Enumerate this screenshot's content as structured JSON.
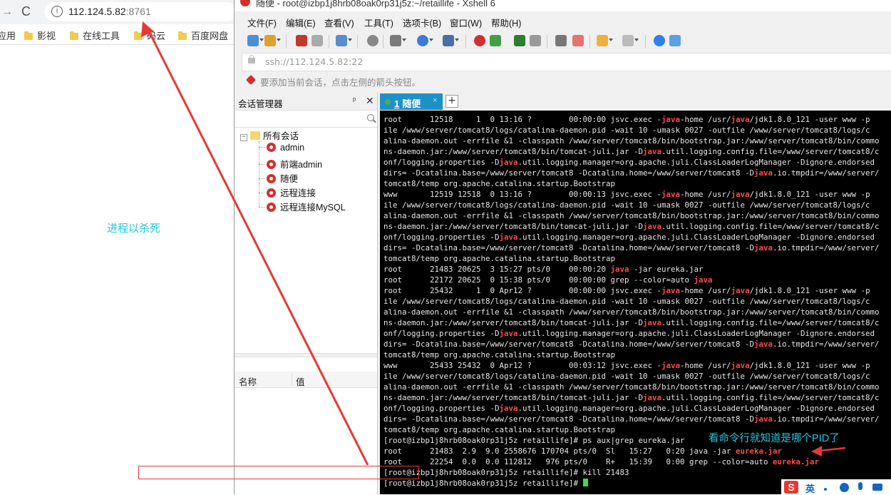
{
  "browser": {
    "back_glyph": "→",
    "reload_glyph": "C",
    "info_glyph": "i",
    "url_host": "112.124.5.82",
    "url_port": ":8761",
    "bookmarks": [
      {
        "label": "应用",
        "folder": false
      },
      {
        "label": "影视",
        "folder": true
      },
      {
        "label": "在线工具",
        "folder": true
      },
      {
        "label": "码云",
        "folder": true
      },
      {
        "label": "百度网盘",
        "folder": true
      }
    ],
    "note": "进程以杀死"
  },
  "xshell": {
    "title": "随便 - root@izbp1j8hrb08oak0rp31j5z:~/retaillife - Xshell 6",
    "menu": [
      "文件(F)",
      "编辑(E)",
      "查看(V)",
      "工具(T)",
      "选项卡(B)",
      "窗口(W)",
      "帮助(H)"
    ],
    "address": "ssh://112.124.5.82:22",
    "hint": "要添加当前会话，点击左侧的箭头按钮。",
    "session_manager": {
      "title": "会话管理器",
      "pin_glyph": "ᵖ",
      "close_glyph": "✕",
      "root": "所有会话",
      "items": [
        "admin",
        "前端admin",
        "随便",
        "远程连接",
        "远程连接MySQL"
      ],
      "props_col_name": "名称",
      "props_col_value": "值"
    },
    "tab": {
      "number": "1",
      "label": "随便",
      "close_glyph": "×",
      "new_glyph": "+"
    },
    "colors": {
      "highlight": "#ff4b4b",
      "tab": "#1e90c8",
      "annotation": "#26c6da",
      "arrow": "#e53935"
    }
  },
  "terminal": {
    "lines": [
      [
        {
          "t": "root      12518     1  0 13:16 ?        00:00:00 jsvc.exec -"
        },
        {
          "t": "java",
          "h": true
        },
        {
          "t": "-home /usr/"
        },
        {
          "t": "java",
          "h": true
        },
        {
          "t": "/jdk1.8.0_121 -user www -p"
        }
      ],
      [
        {
          "t": "ile /www/server/tomcat8/logs/catalina-daemon.pid -wait 10 -umask 0027 -outfile /www/server/tomcat8/logs/c"
        }
      ],
      [
        {
          "t": "alina-daemon.out -errfile &1 -classpath /www/server/tomcat8/bin/bootstrap.jar:/www/server/tomcat8/bin/commo"
        }
      ],
      [
        {
          "t": "ns-daemon.jar:/www/server/tomcat8/bin/tomcat-juli.jar -D"
        },
        {
          "t": "java",
          "h": true
        },
        {
          "t": ".util.logging.config.file=/www/server/tomcat8/c"
        }
      ],
      [
        {
          "t": "onf/logging.properties -D"
        },
        {
          "t": "java",
          "h": true
        },
        {
          "t": ".util.logging.manager=org.apache.juli.ClassLoaderLogManager -Dignore.endorsed"
        }
      ],
      [
        {
          "t": "dirs= -Dcatalina.base=/www/server/tomcat8 -Dcatalina.home=/www/server/tomcat8 -D"
        },
        {
          "t": "java",
          "h": true
        },
        {
          "t": ".io.tmpdir=/www/server/"
        }
      ],
      [
        {
          "t": "tomcat8/temp org.apache.catalina.startup.Bootstrap"
        }
      ],
      [
        {
          "t": "www       12519 12518  0 13:16 ?        00:00:13 jsvc.exec -"
        },
        {
          "t": "java",
          "h": true
        },
        {
          "t": "-home /usr/"
        },
        {
          "t": "java",
          "h": true
        },
        {
          "t": "/jdk1.8.0_121 -user www -p"
        }
      ],
      [
        {
          "t": "ile /www/server/tomcat8/logs/catalina-daemon.pid -wait 10 -umask 0027 -outfile /www/server/tomcat8/logs/c"
        }
      ],
      [
        {
          "t": "alina-daemon.out -errfile &1 -classpath /www/server/tomcat8/bin/bootstrap.jar:/www/server/tomcat8/bin/commo"
        }
      ],
      [
        {
          "t": "ns-daemon.jar:/www/server/tomcat8/bin/tomcat-juli.jar -D"
        },
        {
          "t": "java",
          "h": true
        },
        {
          "t": ".util.logging.config.file=/www/server/tomcat8/c"
        }
      ],
      [
        {
          "t": "onf/logging.properties -D"
        },
        {
          "t": "java",
          "h": true
        },
        {
          "t": ".util.logging.manager=org.apache.juli.ClassLoaderLogManager -Dignore.endorsed"
        }
      ],
      [
        {
          "t": "dirs= -Dcatalina.base=/www/server/tomcat8 -Dcatalina.home=/www/server/tomcat8 -D"
        },
        {
          "t": "java",
          "h": true
        },
        {
          "t": ".io.tmpdir=/www/server/"
        }
      ],
      [
        {
          "t": "tomcat8/temp org.apache.catalina.startup.Bootstrap"
        }
      ],
      [
        {
          "t": "root      21483 20625  3 15:27 pts/0    00:00:20 "
        },
        {
          "t": "java",
          "h": true
        },
        {
          "t": " -jar eureka.jar"
        }
      ],
      [
        {
          "t": "root      22172 20625  0 15:38 pts/0    00:00:00 grep --color=auto "
        },
        {
          "t": "java",
          "h": true
        }
      ],
      [
        {
          "t": "root      25432     1  0 Apr12 ?        00:00:00 jsvc.exec -"
        },
        {
          "t": "java",
          "h": true
        },
        {
          "t": "-home /usr/"
        },
        {
          "t": "java",
          "h": true
        },
        {
          "t": "/jdk1.8.0_121 -user www -p"
        }
      ],
      [
        {
          "t": "ile /www/server/tomcat8/logs/catalina-daemon.pid -wait 10 -umask 0027 -outfile /www/server/tomcat8/logs/c"
        }
      ],
      [
        {
          "t": "alina-daemon.out -errfile &1 -classpath /www/server/tomcat8/bin/bootstrap.jar:/www/server/tomcat8/bin/commo"
        }
      ],
      [
        {
          "t": "ns-daemon.jar:/www/server/tomcat8/bin/tomcat-juli.jar -D"
        },
        {
          "t": "java",
          "h": true
        },
        {
          "t": ".util.logging.config.file=/www/server/tomcat8/c"
        }
      ],
      [
        {
          "t": "onf/logging.properties -D"
        },
        {
          "t": "java",
          "h": true
        },
        {
          "t": ".util.logging.manager=org.apache.juli.ClassLoaderLogManager -Dignore.endorsed"
        }
      ],
      [
        {
          "t": "dirs= -Dcatalina.base=/www/server/tomcat8 -Dcatalina.home=/www/server/tomcat8 -D"
        },
        {
          "t": "java",
          "h": true
        },
        {
          "t": ".io.tmpdir=/www/server/"
        }
      ],
      [
        {
          "t": "tomcat8/temp org.apache.catalina.startup.Bootstrap"
        }
      ],
      [
        {
          "t": "www       25433 25432  0 Apr12 ?        00:03:12 jsvc.exec -"
        },
        {
          "t": "java",
          "h": true
        },
        {
          "t": "-home /usr/"
        },
        {
          "t": "java",
          "h": true
        },
        {
          "t": "/jdk1.8.0_121 -user www -p"
        }
      ],
      [
        {
          "t": "ile /www/server/tomcat8/logs/catalina-daemon.pid -wait 10 -umask 0027 -outfile /www/server/tomcat8/logs/c"
        }
      ],
      [
        {
          "t": "alina-daemon.out -errfile &1 -classpath /www/server/tomcat8/bin/bootstrap.jar:/www/server/tomcat8/bin/commo"
        }
      ],
      [
        {
          "t": "ns-daemon.jar:/www/server/tomcat8/bin/tomcat-juli.jar -D"
        },
        {
          "t": "java",
          "h": true
        },
        {
          "t": ".util.logging.config.file=/www/server/tomcat8/c"
        }
      ],
      [
        {
          "t": "onf/logging.properties -D"
        },
        {
          "t": "java",
          "h": true
        },
        {
          "t": ".util.logging.manager=org.apache.juli.ClassLoaderLogManager -Dignore.endorsed"
        }
      ],
      [
        {
          "t": "dirs= -Dcatalina.base=/www/server/tomcat8 -Dcatalina.home=/www/server/tomcat8 -D"
        },
        {
          "t": "java",
          "h": true
        },
        {
          "t": ".io.tmpdir=/www/server/"
        }
      ],
      [
        {
          "t": "tomcat8/temp org.apache.catalina.startup.Bootstrap"
        }
      ],
      [
        {
          "t": "[root@izbp1j8hrb08oak0rp31j5z retaillife]# ps aux|grep eureka.jar"
        }
      ],
      [
        {
          "t": "root      21483  2.9  9.0 2558676 170704 pts/0  Sl   15:27   0:20 java -jar "
        },
        {
          "t": "eureka.jar",
          "h": true
        }
      ],
      [
        {
          "t": "root      22254  0.0  0.0 112812   976 pts/0    R+   15:39   0:00 grep --color=auto "
        },
        {
          "t": "eureka.jar",
          "h": true
        }
      ],
      [
        {
          "t": "[root@izbp1j8hrb08oak0rp31j5z retaillife]# kill 21483"
        }
      ],
      [
        {
          "t": "[root@izbp1j8hrb08oak0rp31j5z retaillife]# "
        },
        {
          "cursor": true
        }
      ]
    ],
    "annotation": "看命令行就知道是哪个PID了"
  },
  "ime": {
    "logo": "S",
    "lang": "英"
  }
}
